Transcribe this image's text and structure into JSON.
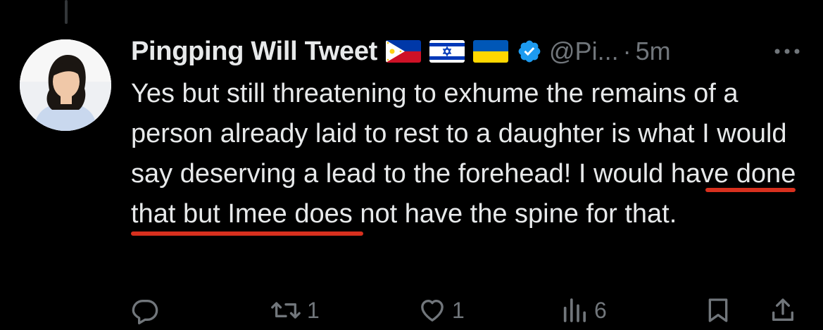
{
  "tweet": {
    "display_name": "Pingping Will Tweet",
    "handle": "@Pi...",
    "separator": "·",
    "time": "5m",
    "flags": [
      "philippines-flag",
      "israel-flag",
      "ukraine-flag"
    ],
    "verified": true,
    "text": "Yes but still threatening to exhume the remains of a person already laid to rest to a daughter is what I would say deserving a lead to the forehead! I would have done that but Imee does not have the spine for that.",
    "annotation_color": "#d8301e"
  },
  "actions": {
    "reply": {
      "icon": "reply-icon",
      "count": ""
    },
    "retweet": {
      "icon": "retweet-icon",
      "count": "1"
    },
    "like": {
      "icon": "like-icon",
      "count": "1"
    },
    "views": {
      "icon": "views-icon",
      "count": "6"
    },
    "bookmark": {
      "icon": "bookmark-icon"
    },
    "share": {
      "icon": "share-icon"
    }
  },
  "colors": {
    "background": "#000000",
    "text": "#e7e9ea",
    "secondary": "#71767b",
    "verified": "#1d9bf0"
  }
}
